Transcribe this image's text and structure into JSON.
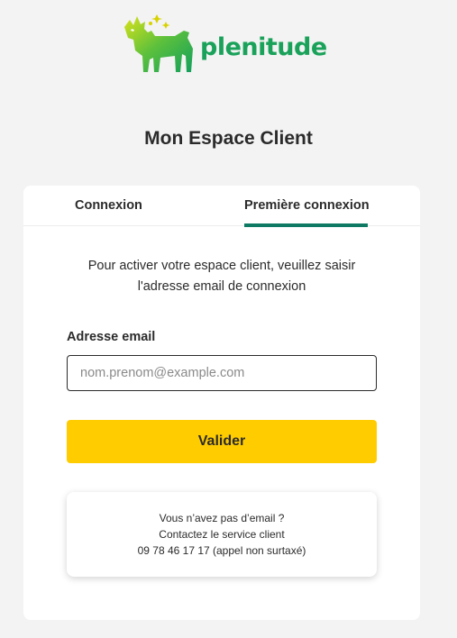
{
  "brand": {
    "name": "plenitude",
    "primary_color": "#1aa25a",
    "accent_color": "#d4e000"
  },
  "page": {
    "title": "Mon Espace Client"
  },
  "tabs": [
    {
      "label": "Connexion",
      "active": false
    },
    {
      "label": "Première connexion",
      "active": true
    }
  ],
  "form": {
    "intro_line1": "Pour activer votre espace client, veuillez saisir",
    "intro_line2": "l'adresse email de connexion",
    "email_label": "Adresse email",
    "email_placeholder": "nom.prenom@example.com",
    "email_value": "",
    "submit_label": "Valider",
    "submit_color": "#ffcc00"
  },
  "help": {
    "line1": "Vous n’avez pas d’email ?",
    "line2": "Contactez le service client",
    "line3": "09 78 46 17 17 (appel non surtaxé)"
  }
}
